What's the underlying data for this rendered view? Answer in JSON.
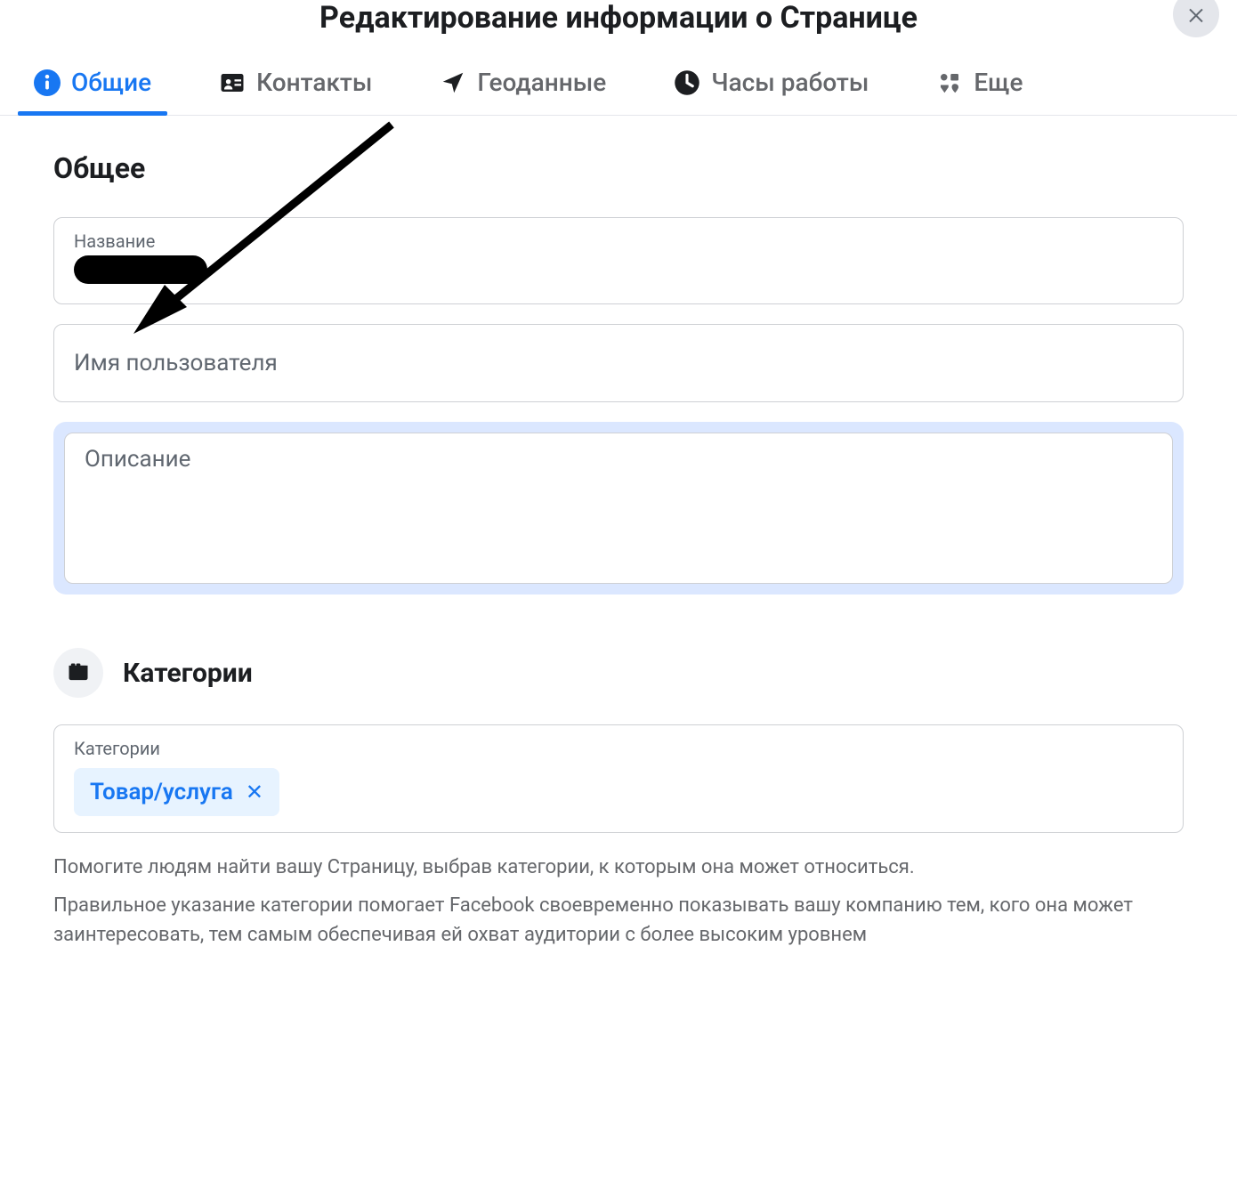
{
  "header": {
    "title": "Редактирование информации о Странице"
  },
  "tabs": {
    "general": "Общие",
    "contacts": "Контакты",
    "geodata": "Геоданные",
    "hours": "Часы работы",
    "more": "Еще"
  },
  "section": {
    "general_title": "Общее",
    "name_label": "Название",
    "username_placeholder": "Имя пользователя",
    "description_placeholder": "Описание"
  },
  "categories": {
    "header": "Категории",
    "label": "Категории",
    "chip_value": "Товар/услуга",
    "help1": "Помогите людям найти вашу Страницу, выбрав категории, к которым она может относиться.",
    "help2": "Правильное указание категории помогает Facebook своевременно показывать вашу компанию тем, кого она может заинтересовать, тем самым обеспечивая ей охват аудитории с более высоким уровнем"
  }
}
